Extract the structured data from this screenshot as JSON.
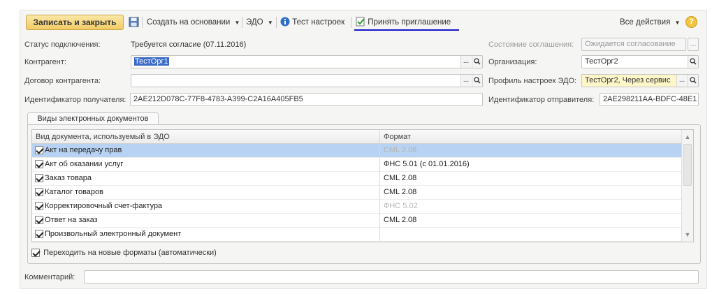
{
  "toolbar": {
    "save_close": "Записать и закрыть",
    "create_based_on": "Создать на основании",
    "edo": "ЭДО",
    "test_settings": "Тест настроек",
    "accept_invitation": "Принять приглашение",
    "all_actions": "Все действия",
    "help": "?"
  },
  "form": {
    "connection_status_label": "Статус подключения:",
    "connection_status_value": "Требуется согласие (07.11.2016)",
    "agreement_status_label": "Состояние соглашения:",
    "agreement_status_value": "Ожидается согласование",
    "counterparty_label": "Контрагент:",
    "counterparty_value": "ТестОрг1",
    "organization_label": "Организация:",
    "organization_value": "ТестОрг2",
    "contract_label": "Договор контрагента:",
    "contract_value": "",
    "profile_label": "Профиль настроек ЭДО:",
    "profile_value": "ТестОрг2, Через сервис",
    "recipient_id_label": "Идентификатор получателя:",
    "recipient_id_value": "2AE212D078C-77F8-4783-A399-C2A16A405FB5",
    "sender_id_label": "Идентификатор отправителя:",
    "sender_id_value": "2AE298211AA-BDFC-48E1",
    "dots": "...",
    "search_glyph": "🔍"
  },
  "tab": {
    "label": "Виды электронных документов"
  },
  "grid": {
    "columns": [
      "Вид документа, используемый в ЭДО",
      "Формат"
    ],
    "rows": [
      {
        "doc": "Акт на передачу прав",
        "format": "CML 2.08",
        "dim": true,
        "selected": true
      },
      {
        "doc": "Акт об оказании услуг",
        "format": "ФНС 5.01 (с 01.01.2016)",
        "dim": false,
        "selected": false
      },
      {
        "doc": "Заказ товара",
        "format": "CML 2.08",
        "dim": false,
        "selected": false
      },
      {
        "doc": "Каталог товаров",
        "format": "CML 2.08",
        "dim": false,
        "selected": false
      },
      {
        "doc": "Корректировочный счет-фактура",
        "format": "ФНС 5.02",
        "dim": true,
        "selected": false
      },
      {
        "doc": "Ответ на заказ",
        "format": "CML 2.08",
        "dim": false,
        "selected": false
      },
      {
        "doc": "Произвольный электронный документ",
        "format": "",
        "dim": false,
        "selected": false
      }
    ]
  },
  "auto_formats_label": "Переходить на новые форматы (автоматически)",
  "comment_label": "Комментарий:",
  "comment_value": ""
}
